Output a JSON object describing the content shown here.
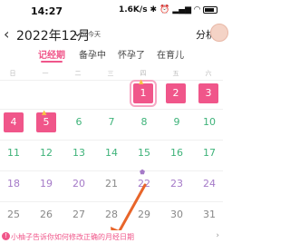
{
  "status": {
    "time": "14:27",
    "net_speed": "1.6K/s",
    "icons": [
      "bluetooth-icon",
      "alarm-icon",
      "signal-icon",
      "wifi-icon",
      "battery-icon"
    ]
  },
  "header": {
    "back_icon": "chevron-left-icon",
    "title": "2022年12月",
    "today_label": "回今天",
    "share_label": "分析"
  },
  "tabs": [
    {
      "label": "记经期",
      "active": true
    },
    {
      "label": "备孕中",
      "active": false
    },
    {
      "label": "怀孕了",
      "active": false
    },
    {
      "label": "在育儿",
      "active": false
    }
  ],
  "weekdays": [
    "日",
    "一",
    "二",
    "三",
    "四",
    "五",
    "六"
  ],
  "calendar": {
    "row1": [
      "1",
      "2",
      "3"
    ],
    "row2": [
      "4",
      "5",
      "6",
      "7",
      "8",
      "9",
      "10"
    ],
    "row3": [
      "11",
      "12",
      "13",
      "14",
      "15",
      "16",
      "17"
    ],
    "row4": [
      "18",
      "19",
      "20",
      "21",
      "22",
      "23",
      "24"
    ],
    "row5": [
      "25",
      "26",
      "27",
      "28",
      "29",
      "30",
      "31"
    ]
  },
  "notice": {
    "icon": "!",
    "text": "小柚子告诉你如何修改正确的月经日期"
  },
  "colors": {
    "accent": "#f0568a",
    "green": "#3fb37a",
    "purple": "#a57ac8"
  }
}
